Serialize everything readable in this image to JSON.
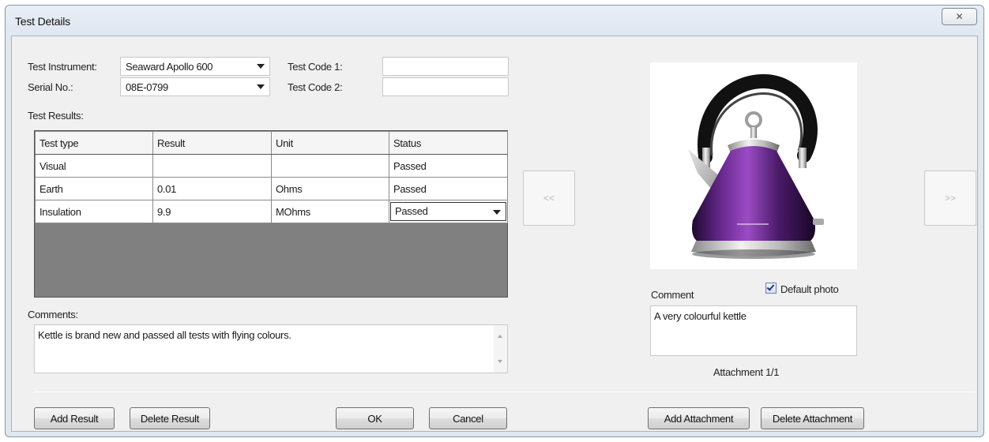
{
  "window": {
    "title": "Test Details",
    "close_glyph": "✕"
  },
  "form": {
    "instrument_label": "Test Instrument:",
    "instrument_value": "Seaward Apollo 600",
    "serial_label": "Serial No.:",
    "serial_value": "08E-0799",
    "code1_label": "Test Code 1:",
    "code1_value": "",
    "code2_label": "Test Code 2:",
    "code2_value": "",
    "results_label": "Test Results:"
  },
  "results": {
    "columns": [
      "Test type",
      "Result",
      "Unit",
      "Status"
    ],
    "rows": [
      [
        "Visual",
        "",
        "",
        "Passed"
      ],
      [
        "Earth",
        "0.01",
        "Ohms",
        "Passed"
      ],
      [
        "Insulation",
        "9.9",
        "MOhms",
        "Passed"
      ]
    ]
  },
  "comments": {
    "label": "Comments:",
    "text": "Kettle is brand new and passed all tests with flying colours."
  },
  "attachment": {
    "prev_label": "<<",
    "next_label": ">>",
    "comment_label": "Comment",
    "default_photo_label": "Default photo",
    "default_photo_checked": true,
    "comment_text": "A very colourful kettle",
    "counter": "Attachment 1/1",
    "photo_icon": "kettle-photo"
  },
  "buttons": {
    "add_result": "Add Result",
    "delete_result": "Delete Result",
    "ok": "OK",
    "cancel": "Cancel",
    "add_attachment": "Add Attachment",
    "delete_attachment": "Delete Attachment"
  },
  "colors": {
    "grid_empty": "#808080",
    "kettle_body": "#4a1a68"
  }
}
